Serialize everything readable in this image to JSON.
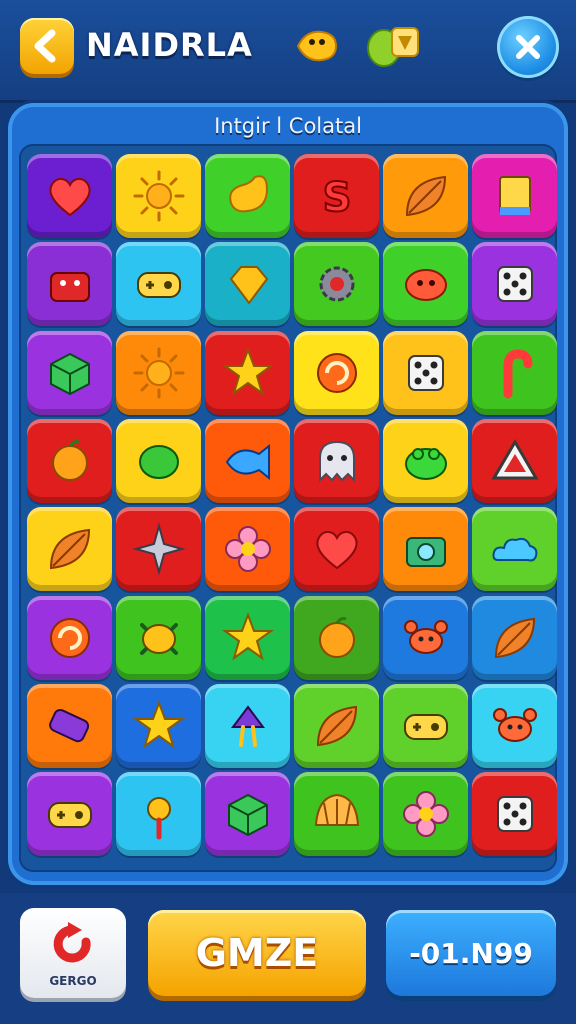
{
  "header": {
    "title": "NAIDRLA",
    "back_icon": "back-arrow-icon",
    "close_icon": "close-icon",
    "status_icons": [
      "fish-icon",
      "coin-badge-icon"
    ]
  },
  "board": {
    "subtitle": "Intgir l Colatal",
    "rows": [
      [
        {
          "color": "#6b1fd1",
          "icon": "heart-icon"
        },
        {
          "color": "#ffd21a",
          "icon": "sun-icon"
        },
        {
          "color": "#3fd12a",
          "icon": "jellybean-icon"
        },
        {
          "color": "#e01e1e",
          "icon": "candy-s-icon"
        },
        {
          "color": "#ff9a0a",
          "icon": "leaf-icon"
        },
        {
          "color": "#e41fb0",
          "icon": "book-icon"
        }
      ],
      [
        {
          "color": "#8a2ed6",
          "icon": "cake-icon"
        },
        {
          "color": "#2ec4f2",
          "icon": "gamepad-icon"
        },
        {
          "color": "#1ab0c8",
          "icon": "gem-icon"
        },
        {
          "color": "#43c91f",
          "icon": "gear-icon"
        },
        {
          "color": "#3fd12a",
          "icon": "blob-icon"
        },
        {
          "color": "#9b32e0",
          "icon": "dice-icon"
        }
      ],
      [
        {
          "color": "#9b32e0",
          "icon": "cube-icon"
        },
        {
          "color": "#ff8a0a",
          "icon": "sun-icon"
        },
        {
          "color": "#e01e1e",
          "icon": "star-icon"
        },
        {
          "color": "#ffe21a",
          "icon": "swirl-icon"
        },
        {
          "color": "#ffc21a",
          "icon": "dice-icon"
        },
        {
          "color": "#3fc41f",
          "icon": "candy-cane-icon"
        }
      ],
      [
        {
          "color": "#e01e1e",
          "icon": "orange-icon"
        },
        {
          "color": "#ffd21a",
          "icon": "lime-icon"
        },
        {
          "color": "#ff5a0a",
          "icon": "fish-icon"
        },
        {
          "color": "#e01e1e",
          "icon": "ghost-icon"
        },
        {
          "color": "#ffd21a",
          "icon": "frog-icon"
        },
        {
          "color": "#e01e1e",
          "icon": "triangle-icon"
        }
      ],
      [
        {
          "color": "#ffd21a",
          "icon": "leaf-icon"
        },
        {
          "color": "#e01e1e",
          "icon": "shuriken-icon"
        },
        {
          "color": "#ff5a0a",
          "icon": "flower-icon"
        },
        {
          "color": "#e01e1e",
          "icon": "heart-icon"
        },
        {
          "color": "#ff8a0a",
          "icon": "camera-icon"
        },
        {
          "color": "#5fd12a",
          "icon": "cloud-icon"
        }
      ],
      [
        {
          "color": "#9b32e0",
          "icon": "swirl-icon"
        },
        {
          "color": "#3fc41f",
          "icon": "turtle-icon"
        },
        {
          "color": "#1ec24a",
          "icon": "star-icon"
        },
        {
          "color": "#3fa81f",
          "icon": "orange-icon"
        },
        {
          "color": "#1f7ae0",
          "icon": "crab-icon"
        },
        {
          "color": "#1f8ae0",
          "icon": "leaf-icon"
        }
      ],
      [
        {
          "color": "#ff7a0a",
          "icon": "battery-icon"
        },
        {
          "color": "#1f6ee0",
          "icon": "star-icon"
        },
        {
          "color": "#38d2f2",
          "icon": "squid-icon"
        },
        {
          "color": "#5fd12a",
          "icon": "leaf-icon"
        },
        {
          "color": "#5fd12a",
          "icon": "gamepad-icon"
        },
        {
          "color": "#38d2f2",
          "icon": "crab-icon"
        }
      ],
      [
        {
          "color": "#9b32e0",
          "icon": "gamepad-icon"
        },
        {
          "color": "#2ec4f2",
          "icon": "key-icon"
        },
        {
          "color": "#9b32e0",
          "icon": "cube-icon"
        },
        {
          "color": "#3fc41f",
          "icon": "shell-icon"
        },
        {
          "color": "#3fc41f",
          "icon": "flower-icon"
        },
        {
          "color": "#e01e1e",
          "icon": "dice-icon"
        }
      ]
    ]
  },
  "footer": {
    "left_button_label": "GERGO",
    "main_button_label": "GMZE",
    "right_button_label": "-01.N99"
  }
}
